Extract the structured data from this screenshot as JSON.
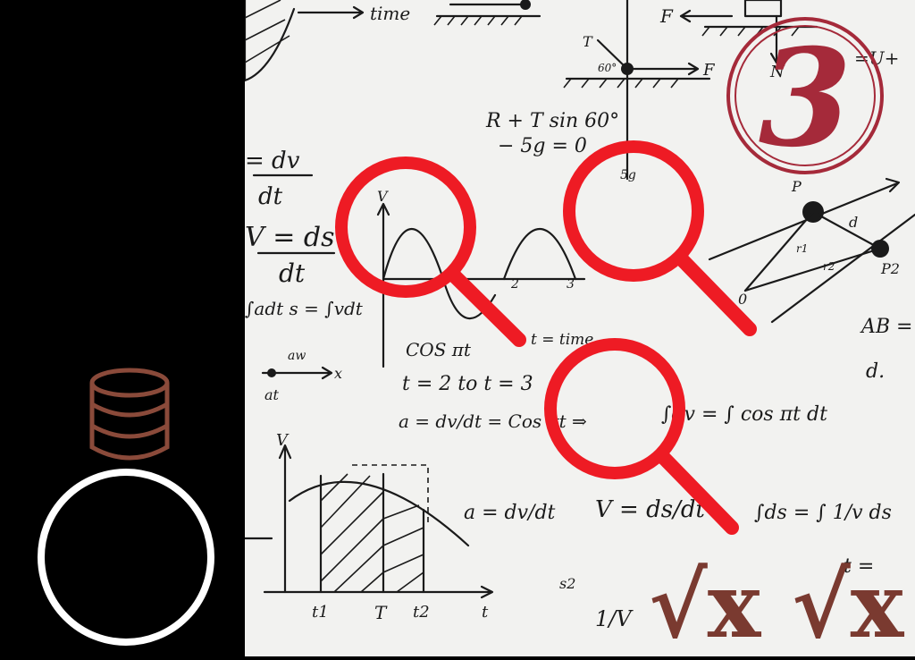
{
  "colors": {
    "left_panel": "#000000",
    "board": "#f2f2f0",
    "magnifier": "#ee1b24",
    "badge": "#a52a3a",
    "database_icon": "#8a4a3a",
    "sqrt_glyphs": "#7a3a30"
  },
  "icons": [
    "database-icon",
    "circle-outline-icon",
    "magnifier-icon",
    "badge-circle-icon",
    "sqrt-x-icon"
  ],
  "badge": {
    "number": "3"
  },
  "sqrt_glyphs": [
    "√x",
    "√x"
  ],
  "equations": {
    "time_label": "time",
    "f_left": "F",
    "f_right": "F",
    "t_label": "T",
    "angle_60": "60°",
    "n_label": "N",
    "u_label": "=U+",
    "eq1_line1": "R + T sin 60°",
    "eq1_line2": "− 5g = 0",
    "sg_label": "5g",
    "dv_num": "= dv",
    "dv_den": "dt",
    "ds_num": "V = ds",
    "ds_den": "dt",
    "integral_adt": "∫adt  s = ∫vdt",
    "aw_label": "aw",
    "at_label": "at",
    "x_label": "x",
    "cos_label": "COS πt",
    "t_time": "t = time",
    "t_range": "t = 2   to   t = 3",
    "a_dv": "a = dv/dt = Cos πt  ⇒",
    "integral_cos": "∫dv = ∫ cos πt dt",
    "a_dv2": "a = dv/dt",
    "v_ds2": "V = ds/dt",
    "ds_int": "∫ds = ∫ 1/v ds",
    "t_eq": "t =",
    "p1": "P",
    "p2": "P2",
    "d_label": "d",
    "r1": "r1",
    "r2": "r2",
    "o_label": "0",
    "ab_label": "AB =",
    "d_dot": "d.",
    "graph_v": "V",
    "graph_t": "t",
    "t1": "t1",
    "t_cap": "T",
    "t2": "t2",
    "tick2": "2",
    "tick3": "3",
    "s2": "s2",
    "one_over_v": "1/V"
  }
}
